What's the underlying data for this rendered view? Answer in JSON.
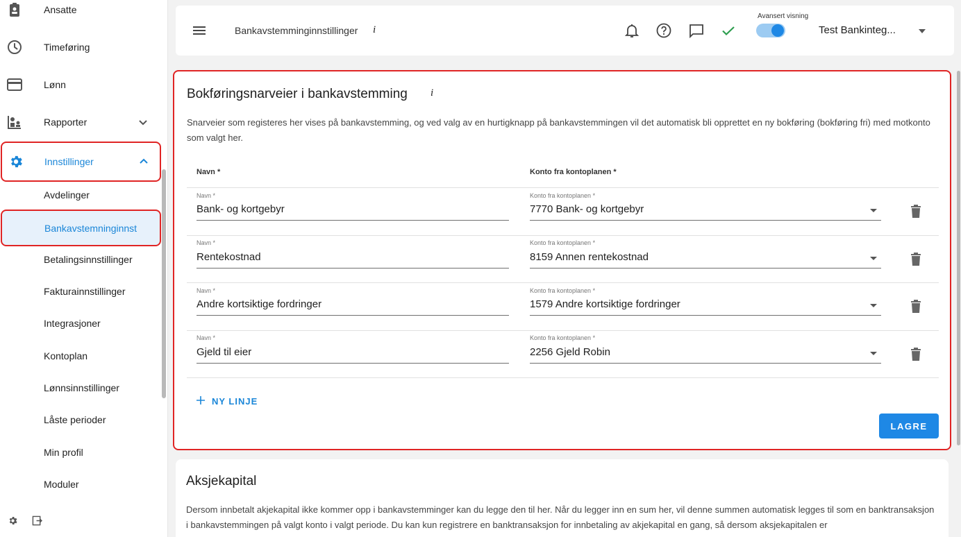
{
  "sidebar": {
    "items": [
      {
        "label": "Ansatte"
      },
      {
        "label": "Timeføring"
      },
      {
        "label": "Lønn"
      },
      {
        "label": "Rapporter"
      },
      {
        "label": "Innstillinger"
      }
    ],
    "subitems": [
      {
        "label": "Avdelinger"
      },
      {
        "label": "Bankavstemninginnst"
      },
      {
        "label": "Betalingsinnstillinger"
      },
      {
        "label": "Fakturainnstillinger"
      },
      {
        "label": "Integrasjoner"
      },
      {
        "label": "Kontoplan"
      },
      {
        "label": "Lønnsinnstillinger"
      },
      {
        "label": "Låste perioder"
      },
      {
        "label": "Min profil"
      },
      {
        "label": "Moduler"
      }
    ]
  },
  "header": {
    "title": "Bankavstemminginnstillinger",
    "info": "i",
    "advanced_label": "Avansert visning",
    "advanced_on": true,
    "company": "Test Bankinteg..."
  },
  "card": {
    "title": "Bokføringsnarveier i bankavstemming",
    "info": "i",
    "description": "Snarveier som registeres her vises på bankavstemming, og ved valg av en hurtigknapp på bankavstemmingen vil det automatisk bli opprettet en ny bokføring (bokføring fri) med motkonto som valgt her.",
    "col_name": "Navn *",
    "col_account": "Konto fra kontoplanen *",
    "field_name_label": "Navn *",
    "field_account_label": "Konto fra kontoplanen *",
    "rows": [
      {
        "name": "Bank- og kortgebyr",
        "account": "7770 Bank- og kortgebyr"
      },
      {
        "name": "Rentekostnad",
        "account": "8159 Annen rentekostnad"
      },
      {
        "name": "Andre kortsiktige fordringer",
        "account": "1579 Andre kortsiktige fordringer"
      },
      {
        "name": "Gjeld til eier",
        "account": "2256 Gjeld Robin"
      }
    ],
    "add_line": "NY LINJE",
    "save": "LAGRE"
  },
  "card2": {
    "title": "Aksjekapital",
    "description": "Dersom innbetalt akjekapital ikke kommer opp i bankavstemminger kan du legge den til her. Når du legger inn en sum her, vil denne summen automatisk legges til som en banktransaksjon i bankavstemmingen på valgt konto i valgt periode. Du kan kun registrere en banktransaksjon for innbetaling av akjekapital en gang, så dersom aksjekapitalen er"
  },
  "colors": {
    "accent": "#1e88e5",
    "highlight": "#e02424",
    "check": "#2e9e4f"
  }
}
